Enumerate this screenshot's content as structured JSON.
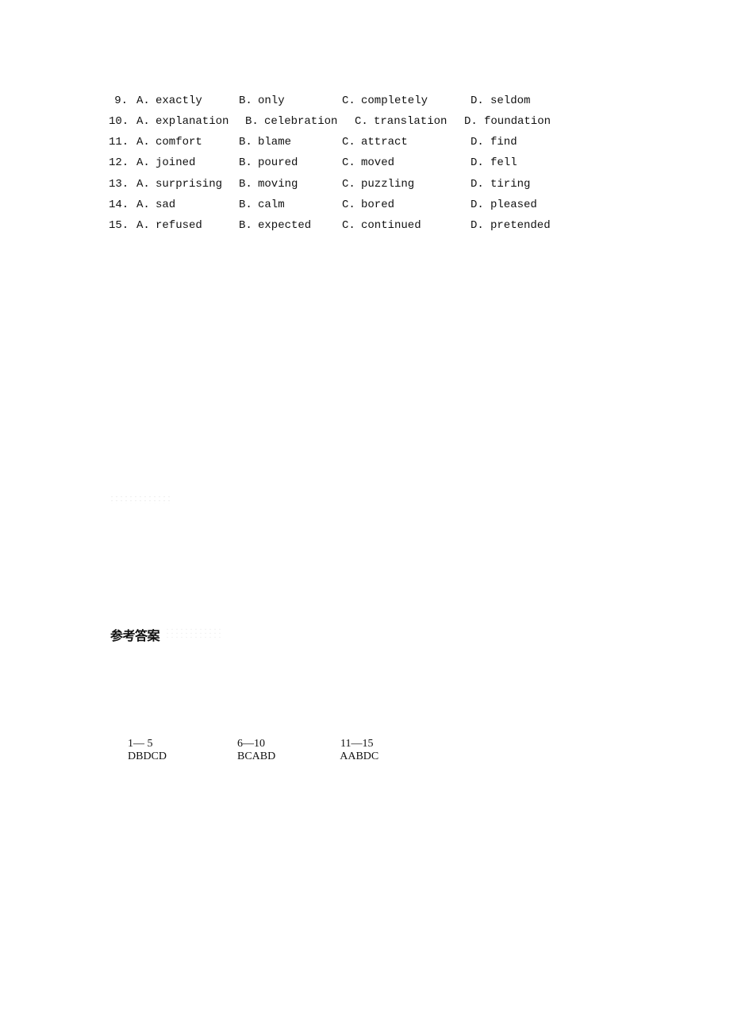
{
  "questions": [
    {
      "num": "9.",
      "a": "exactly",
      "b": "only",
      "c": "completely",
      "d": "seldom"
    },
    {
      "num": "10.",
      "a": "explanation",
      "b": "celebration",
      "c": "translation",
      "d": "foundation"
    },
    {
      "num": "11.",
      "a": "comfort",
      "b": "blame",
      "c": "attract",
      "d": "find"
    },
    {
      "num": "12.",
      "a": "joined",
      "b": "poured",
      "c": "moved",
      "d": "fell"
    },
    {
      "num": "13.",
      "a": "surprising",
      "b": "moving",
      "c": "puzzling",
      "d": "tiring"
    },
    {
      "num": "14.",
      "a": "sad",
      "b": "calm",
      "c": "bored",
      "d": "pleased"
    },
    {
      "num": "15.",
      "a": "refused",
      "b": "expected",
      "c": "continued",
      "d": "pretended"
    }
  ],
  "option_labels": {
    "a": "A.",
    "b": "B.",
    "c": "C.",
    "d": "D."
  },
  "answer_heading": "参考答案",
  "answers": [
    {
      "range": "1— 5",
      "keys": "DBDCD"
    },
    {
      "range": "6—10",
      "keys": "BCABD"
    },
    {
      "range": "11—15",
      "keys": "AABDC"
    }
  ]
}
